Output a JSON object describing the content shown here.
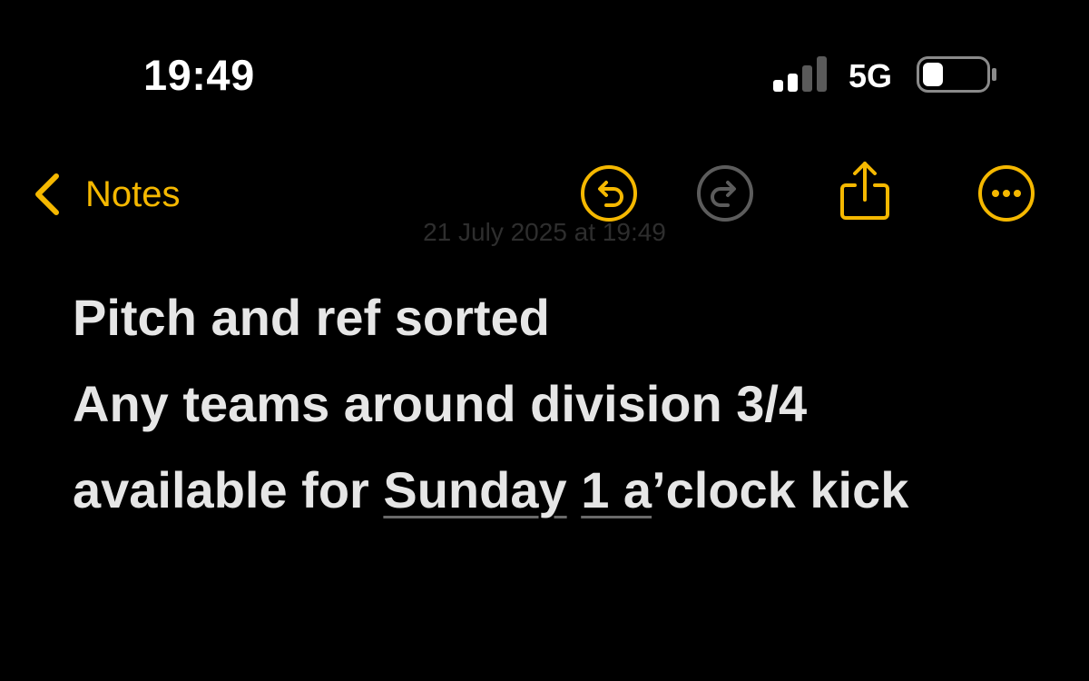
{
  "status_bar": {
    "time": "19:49",
    "network": "5G",
    "signal_bars_filled": 2,
    "signal_bars_total": 4,
    "battery_level": 0.25
  },
  "nav_bar": {
    "back_label": "Notes",
    "accent_color": "#f5b800",
    "icons": [
      "undo-icon",
      "redo-icon",
      "share-icon",
      "more-icon"
    ]
  },
  "note": {
    "date_line": "21 July 2025 at 19:49",
    "line1": "Pitch and ref sorted",
    "line2": "Any teams around division 3/4",
    "line3_prefix": "available for ",
    "line3_link1": "Sunday",
    "line3_space": " ",
    "line3_link2": "1 a",
    "line3_suffix": "’clock kick"
  }
}
